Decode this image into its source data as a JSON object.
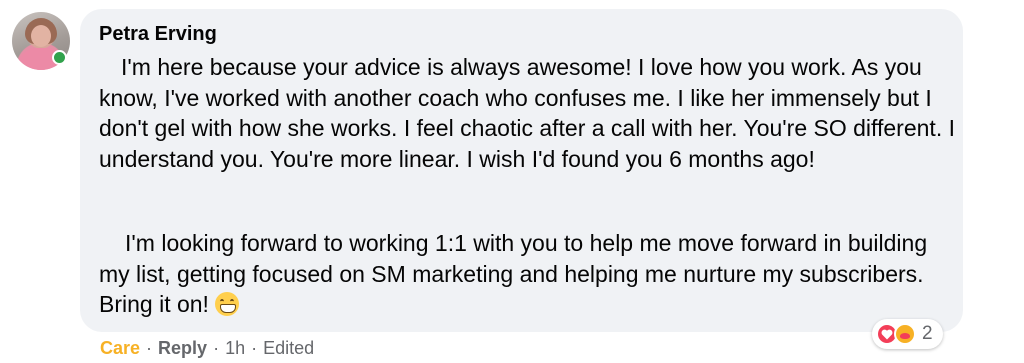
{
  "comment": {
    "author": "Petra Erving",
    "paragraph1": "I'm here because your advice is always awesome! I love how you work. As you know, I've worked with another coach who confuses me. I like her immensely but I don't gel with how she works. I feel chaotic after a call with her. You're SO different. I understand you. You're more linear. I wish I'd found you 6 months ago!",
    "paragraph2": "I'm looking forward to working 1:1 with you to help me move forward in building my list, getting focused on SM marketing and helping me nurture my subscribers. Bring it on!",
    "emoji": "grinning-face-with-teeth",
    "online": true
  },
  "actions": {
    "reaction_label": "Care",
    "reply_label": "Reply",
    "time": "1h",
    "edited_label": "Edited",
    "separator": "·"
  },
  "reactions": {
    "icons": [
      "heart-icon",
      "care-icon"
    ],
    "count": "2"
  },
  "colors": {
    "bubble": "#f0f2f5",
    "care": "#f7b125",
    "secondary_text": "#65676b",
    "online": "#31a24c",
    "love": "#f33e58"
  }
}
